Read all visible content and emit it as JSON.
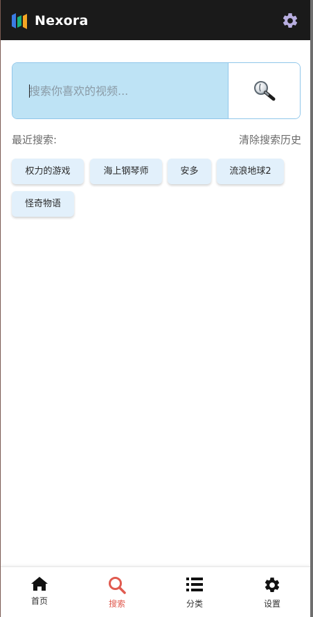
{
  "app": {
    "name": "Nexora"
  },
  "search": {
    "placeholder": "搜索你喜欢的视频..."
  },
  "recent": {
    "label": "最近搜索:",
    "clear_label": "清除搜索历史",
    "tags": [
      "权力的游戏",
      "海上钢琴师",
      "安多",
      "流浪地球2",
      "怪奇物语"
    ]
  },
  "nav": {
    "items": [
      {
        "label": "首页",
        "icon": "home-icon"
      },
      {
        "label": "搜索",
        "icon": "search-icon",
        "active": true
      },
      {
        "label": "分类",
        "icon": "list-icon"
      },
      {
        "label": "设置",
        "icon": "gear-icon"
      }
    ]
  },
  "colors": {
    "accent": "#e05a4f",
    "search_bg": "#bee3f5",
    "border": "#8fc6ea",
    "tag_bg": "#e2f0fb",
    "header_bg": "#1a1a1a"
  }
}
